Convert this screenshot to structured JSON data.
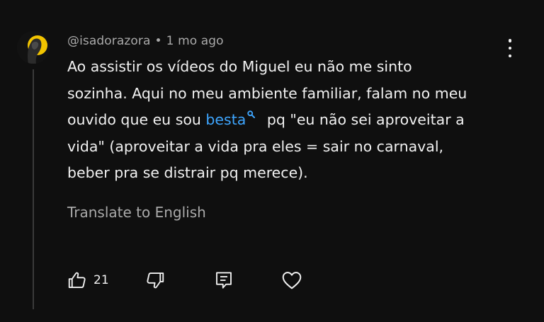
{
  "comment": {
    "author": "@isadorazora",
    "separator": "•",
    "timestamp": "1 mo ago",
    "text_lines": [
      "Ao assistir os vídeos do Miguel eu não me sinto",
      "sozinha. Aqui no meu ambiente familiar, falam no meu",
      "ouvido que eu sou ",
      "besta",
      " pq \"eu não sei aproveitar a",
      "vida\" (aproveitar a vida pra eles = sair no carnaval,",
      "beber pra se distrair pq merece)."
    ],
    "translate_label": "Translate to English",
    "like_count": "21"
  },
  "colors": {
    "background": "#0f0f0f",
    "text": "#f1f1f1",
    "secondary_text": "#aaaaaa",
    "link": "#3ea6ff",
    "thread_line": "#3a3a3a"
  },
  "icons": {
    "avatar": "avatar-image",
    "menu": "more-vert-icon",
    "link_search": "search-icon",
    "like": "thumb-up-icon",
    "dislike": "thumb-down-icon",
    "reply": "comment-icon",
    "heart": "heart-icon"
  }
}
